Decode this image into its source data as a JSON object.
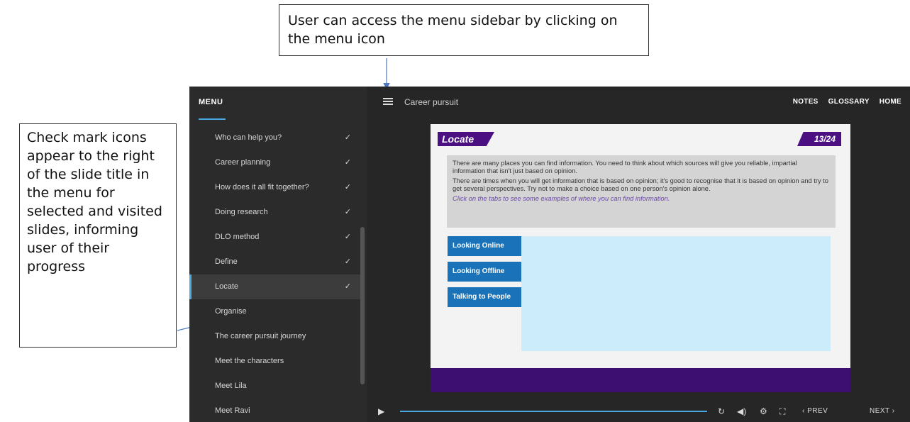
{
  "annotations": {
    "top": "User can access the menu sidebar by clicking on the menu icon",
    "left": "Check mark icons appear to the right of the slide title in the menu for selected and visited slides, informing user of their progress"
  },
  "sidebar": {
    "title": "MENU",
    "items": [
      {
        "label": "Who can help you?",
        "checked": true
      },
      {
        "label": "Career planning",
        "checked": true
      },
      {
        "label": "How does it all fit together?",
        "checked": true
      },
      {
        "label": "Doing research",
        "checked": true
      },
      {
        "label": "DLO method",
        "checked": true
      },
      {
        "label": "Define",
        "checked": true
      },
      {
        "label": "Locate",
        "checked": true,
        "active": true
      },
      {
        "label": "Organise",
        "checked": false
      },
      {
        "label": "The career pursuit journey",
        "checked": false
      },
      {
        "label": "Meet the characters",
        "checked": false
      },
      {
        "label": "Meet Lila",
        "checked": false
      },
      {
        "label": "Meet Ravi",
        "checked": false
      }
    ],
    "check_glyph": "✓"
  },
  "topbar": {
    "course_title": "Career pursuit",
    "links": [
      "NOTES",
      "GLOSSARY",
      "HOME"
    ]
  },
  "slide": {
    "section_tag": "Locate",
    "page_indicator": "13/24",
    "paragraph1": "There are many places you can find information. You need to think about which sources will give you reliable, impartial information that isn't just based on opinion.",
    "paragraph2": "There are times when you will get information that is based on opinion; it's good to recognise that it is based on opinion and try to get several perspectives. Try not to make a choice based on one person's opinion alone.",
    "hint": "Click on the tabs to see some examples of where you can find information.",
    "tabs": [
      "Looking Online",
      "Looking Offline",
      "Talking to People"
    ]
  },
  "controls": {
    "prev_label": "PREV",
    "next_label": "NEXT"
  },
  "colors": {
    "accent_blue": "#4aa8e0",
    "purple": "#4b0f82",
    "tab_blue": "#1a73b8",
    "panel": "#ccecfb"
  }
}
